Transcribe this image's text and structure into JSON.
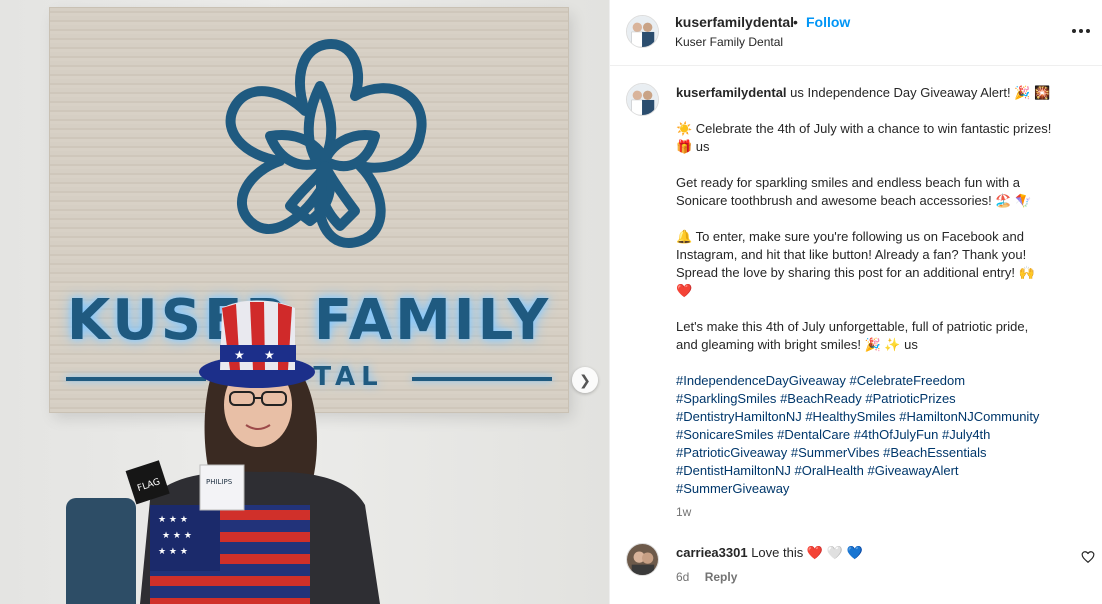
{
  "photo": {
    "sign_text": "KUSER FAMILY",
    "sign_subtext": "DENTAL",
    "next_icon": "chevron-right-icon"
  },
  "header": {
    "username": "kuserfamilydental",
    "separator": "•",
    "follow_label": "Follow",
    "subtitle": "Kuser Family Dental",
    "more_icon": "more-options-icon"
  },
  "caption": {
    "username": "kuserfamilydental",
    "headline": "us Independence Day Giveaway Alert! 🎉 🎇",
    "para1_line1": "☀️ Celebrate the 4th of July with a chance to win fantastic prizes!",
    "para1_line2": "🎁 us",
    "para2_line1": "Get ready for sparkling smiles and endless beach fun with a",
    "para2_line2": "Sonicare toothbrush and awesome beach accessories! 🏖️ 🪁",
    "para3_line1": "🔔 To enter, make sure you're following us on Facebook and",
    "para3_line2": "Instagram, and hit that like button! Already a fan? Thank you!",
    "para3_line3": "Spread the love by sharing this post for an additional entry! 🙌",
    "para3_line4": "❤️",
    "para4_line1": "Let's make this 4th of July unforgettable, full of patriotic pride,",
    "para4_line2": "and gleaming with bright smiles! 🎉 ✨ us",
    "hashtags": [
      [
        "#IndependenceDayGiveaway",
        "#CelebrateFreedom"
      ],
      [
        "#SparklingSmiles",
        "#BeachReady",
        "#PatrioticPrizes"
      ],
      [
        "#DentistryHamiltonNJ",
        "#HealthySmiles",
        "#HamiltonNJCommunity"
      ],
      [
        "#SonicareSmiles",
        "#DentalCare",
        "#4thOfJulyFun",
        "#July4th"
      ],
      [
        "#PatrioticGiveaway",
        "#SummerVibes",
        "#BeachEssentials"
      ],
      [
        "#DentistHamiltonNJ",
        "#OralHealth",
        "#GiveawayAlert"
      ],
      [
        "#SummerGiveaway"
      ]
    ],
    "time_ago": "1w"
  },
  "comment": {
    "username": "carriea3301",
    "text": "Love this ❤️ 🤍 💙",
    "time_ago": "6d",
    "reply_label": "Reply",
    "like_icon": "heart-outline-icon"
  },
  "colors": {
    "link_blue": "#0095f6",
    "hashtag_blue": "#00376b",
    "sign_blue": "#1f5a80",
    "muted_gray": "#737373"
  }
}
